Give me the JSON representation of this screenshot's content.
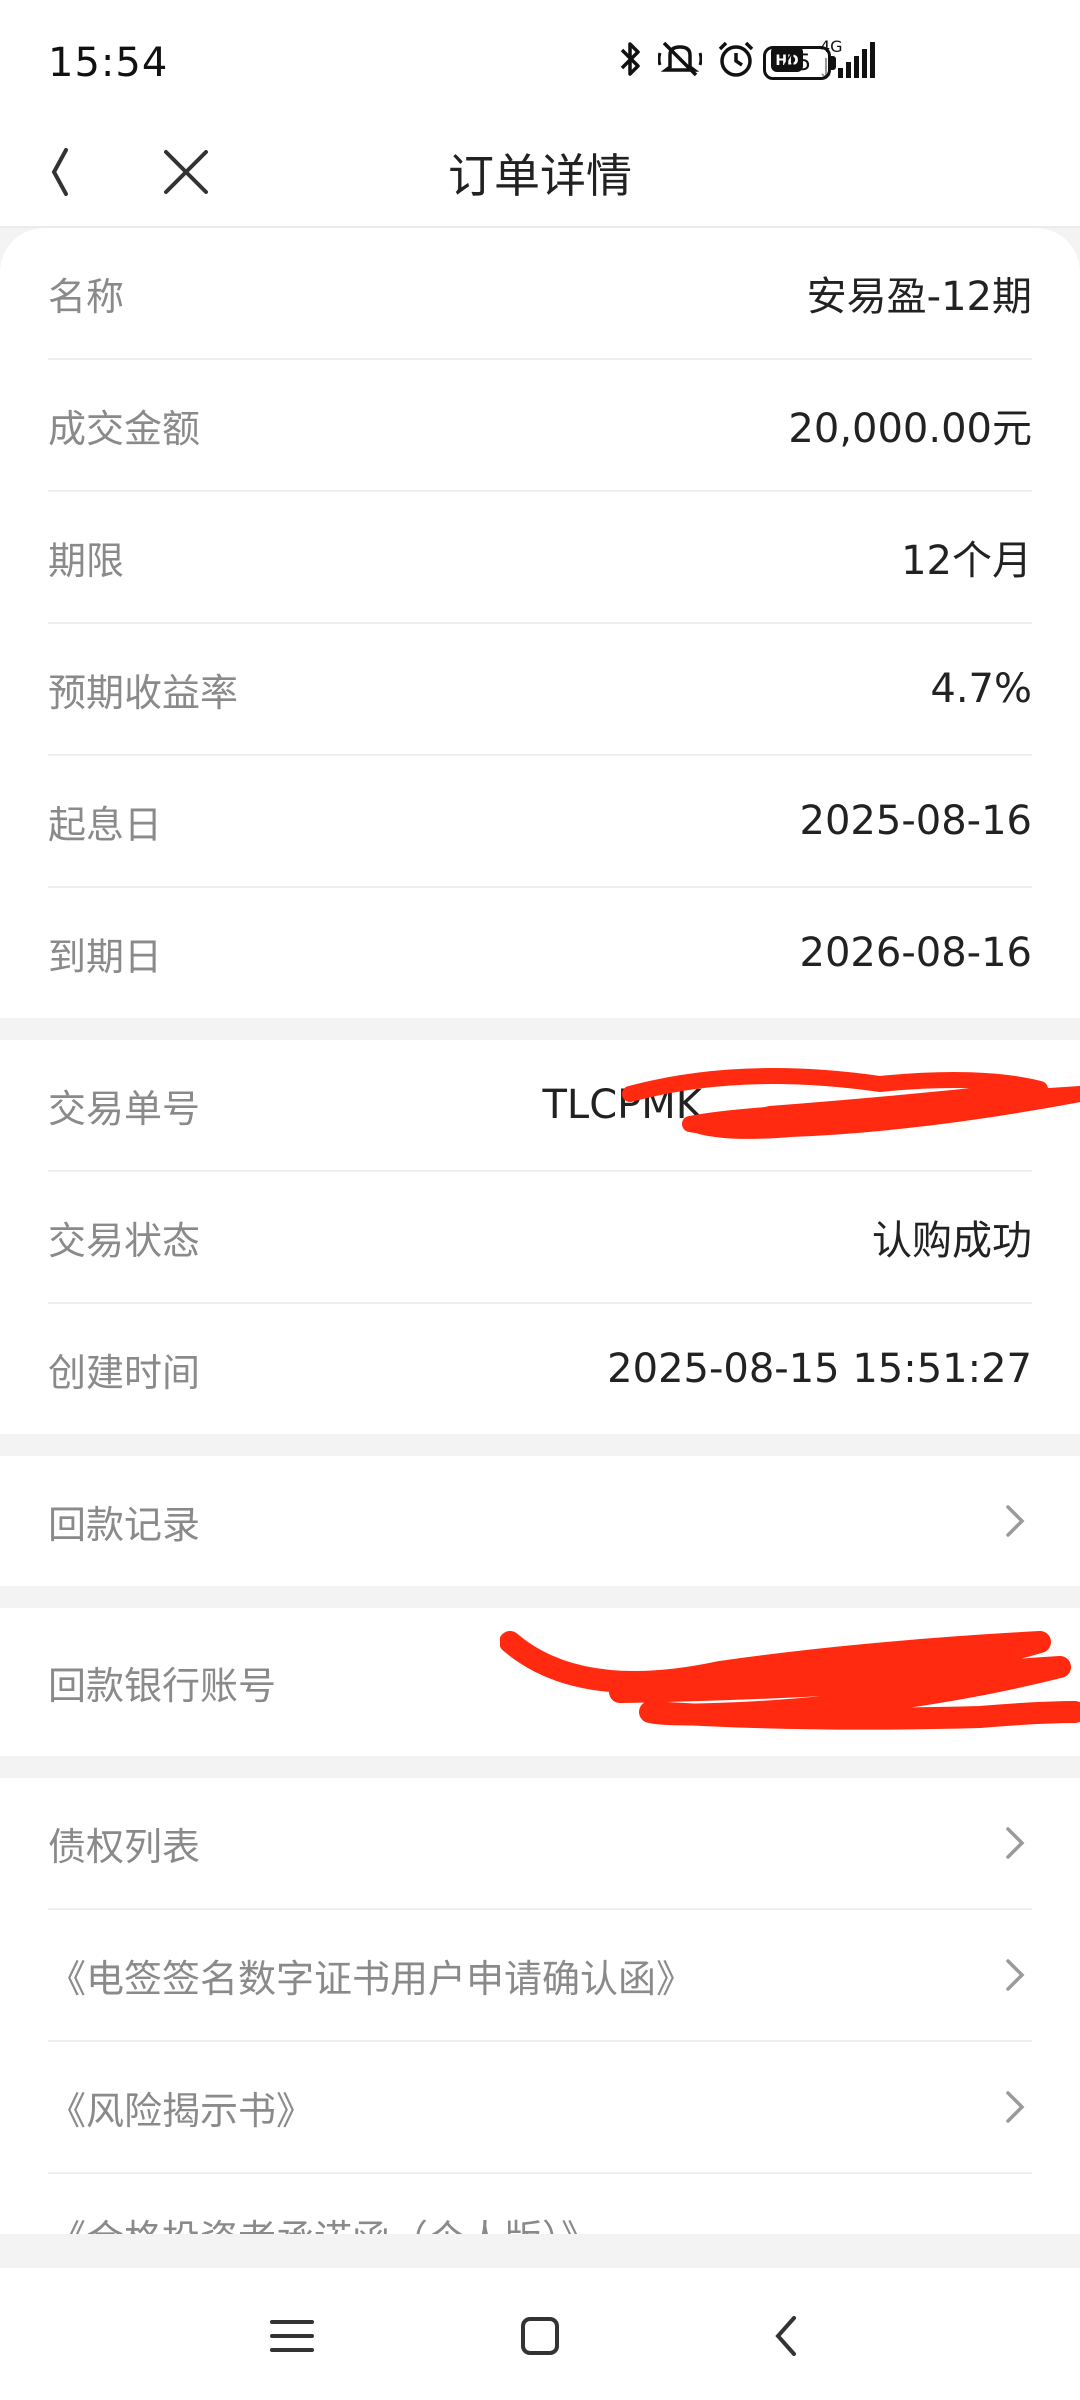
{
  "status_bar": {
    "time": "15:54",
    "network": "4G",
    "battery": "45",
    "icons": [
      "bluetooth-icon",
      "mute-vibrate-icon",
      "alarm-icon",
      "hd-icon",
      "signal-icon",
      "battery-icon"
    ]
  },
  "header": {
    "title": "订单详情",
    "back_icon": "chevron-left-icon",
    "close_icon": "close-icon"
  },
  "order_info": [
    {
      "label": "名称",
      "value": "安易盈-12期"
    },
    {
      "label": "成交金额",
      "value": "20,000.00元"
    },
    {
      "label": "期限",
      "value": "12个月"
    },
    {
      "label": "预期收益率",
      "value": "4.7%"
    },
    {
      "label": "起息日",
      "value": "2025-08-16"
    },
    {
      "label": "到期日",
      "value": "2026-08-16"
    }
  ],
  "transaction_info": [
    {
      "label": "交易单号",
      "value": "TLCPMK"
    },
    {
      "label": "交易状态",
      "value": "认购成功"
    },
    {
      "label": "创建时间",
      "value": "2025-08-15 15:51:27"
    }
  ],
  "links": {
    "repayment_record": "回款记录",
    "repayment_account_label": "回款银行账号",
    "debt_list": "债权列表",
    "esign_cert": "《电签签名数字证书用户申请确认函》",
    "risk_disclosure": "《风险揭示书》",
    "next_item_partial": "《合格投资者承诺函（个人版）》"
  },
  "colors": {
    "background": "#f3f3f3",
    "card": "#ffffff",
    "label": "#8a8a8a",
    "value": "#222222",
    "redaction": "#ff2a10"
  },
  "bottom_nav": [
    "menu-icon",
    "home-icon",
    "back-icon"
  ]
}
